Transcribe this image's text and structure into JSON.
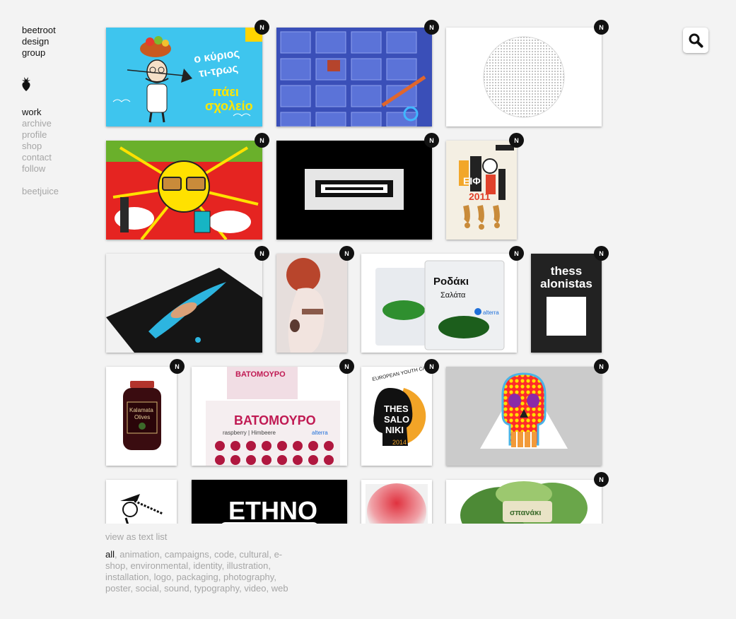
{
  "brand": {
    "line1": "beetroot",
    "line2": "design",
    "line3": "group"
  },
  "nav": {
    "work": "work",
    "archive": "archive",
    "profile": "profile",
    "shop": "shop",
    "contact": "contact",
    "follow": "follow",
    "beetjuice": "beetjuice"
  },
  "icons": {
    "logo": "beet-icon",
    "search": "search-icon",
    "new_badge": "new-badge"
  },
  "badge_label": "N",
  "tiles": {
    "t1": {
      "text1": "ο κύριος",
      "text2": "τι-τρως",
      "text3": "πάει",
      "text4": "σχολείο"
    },
    "t2": {},
    "t3": {},
    "t4": {},
    "t5": {},
    "t6": {
      "text1": "ΕΙΦ",
      "text2": "2011"
    },
    "t7": {},
    "t8": {},
    "t9": {
      "text1": "Ροδάκι",
      "text2": "Σαλάτα",
      "brand": "alterra"
    },
    "t10": {
      "line1": "thess",
      "line2": "alonistas"
    },
    "t11": {
      "text1": "Kalamata",
      "text2": "Olives"
    },
    "t12": {
      "text1": "ΒΑΤΟΜΟΥΡΟ",
      "text2": "ΒΑΤΟΜΟΥΡΟ",
      "text3": "alterra",
      "text4": "raspberry | Himbeere"
    },
    "t13": {
      "top": "EUROPEAN YOUTH CAPITAL",
      "line1": "THES",
      "line2": "SALO",
      "line3": "NIKI",
      "year": "2014"
    },
    "t14": {},
    "t15": {},
    "t16": {
      "text1": "ETHNO"
    },
    "t17": {},
    "t18": {
      "text1": "σπανάκι"
    }
  },
  "footer": {
    "view_text": "view as text list",
    "categories": [
      "all",
      "animation",
      "campaigns",
      "code",
      "cultural",
      "e-shop",
      "environmental",
      "identity",
      "illustration",
      "installation",
      "logo",
      "packaging",
      "photography",
      "poster",
      "social",
      "sound",
      "typography",
      "video",
      "web"
    ]
  },
  "colors": {
    "background": "#f3f3f3",
    "inactive_text": "#a6a6a6",
    "active_text": "#111111",
    "badge": "#111111"
  }
}
